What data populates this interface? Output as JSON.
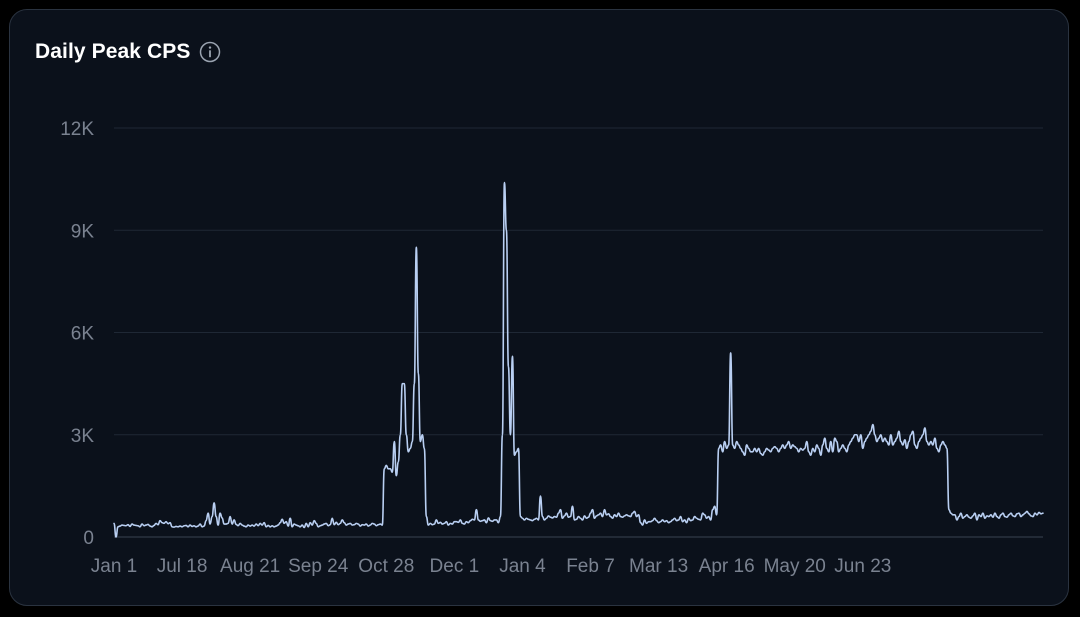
{
  "card": {
    "title": "Daily Peak CPS",
    "info_icon": "info-circle-icon"
  },
  "colors": {
    "background": "#0b111b",
    "border": "#2a3340",
    "line": "#b9cff2",
    "grid": "#1f2835",
    "tick_text": "#7a8290",
    "title_text": "#ffffff"
  },
  "chart_data": {
    "type": "line",
    "title": "Daily Peak CPS",
    "xlabel": "",
    "ylabel": "",
    "ylim": [
      0,
      12000
    ],
    "grid": true,
    "y_ticks": [
      {
        "value": 0,
        "label": "0"
      },
      {
        "value": 3000,
        "label": "3K"
      },
      {
        "value": 6000,
        "label": "6K"
      },
      {
        "value": 9000,
        "label": "9K"
      },
      {
        "value": 12000,
        "label": "12K"
      }
    ],
    "x_ticks": [
      {
        "index": 0,
        "label": "Jan 1"
      },
      {
        "index": 34,
        "label": "Jul 18"
      },
      {
        "index": 68,
        "label": "Aug 21"
      },
      {
        "index": 102,
        "label": "Sep 24"
      },
      {
        "index": 136,
        "label": "Oct 28"
      },
      {
        "index": 170,
        "label": "Dec 1"
      },
      {
        "index": 204,
        "label": "Jan 4"
      },
      {
        "index": 238,
        "label": "Feb 7"
      },
      {
        "index": 272,
        "label": "Mar 13"
      },
      {
        "index": 306,
        "label": "Apr 16"
      },
      {
        "index": 340,
        "label": "May 20"
      },
      {
        "index": 374,
        "label": "Jun 23"
      }
    ],
    "series": [
      {
        "values": [
          400,
          0,
          300,
          320,
          350,
          340,
          330,
          360,
          310,
          380,
          350,
          340,
          330,
          300,
          380,
          330,
          350,
          370,
          320,
          300,
          340,
          400,
          360,
          480,
          420,
          400,
          450,
          390,
          420,
          300,
          290,
          310,
          300,
          320,
          300,
          330,
          340,
          300,
          350,
          310,
          330,
          300,
          320,
          380,
          300,
          320,
          480,
          700,
          380,
          600,
          1000,
          600,
          350,
          700,
          560,
          380,
          380,
          400,
          600,
          380,
          500,
          370,
          330,
          400,
          350,
          320,
          300,
          350,
          320,
          350,
          320,
          380,
          330,
          400,
          350,
          420,
          300,
          340,
          300,
          330,
          300,
          320,
          350,
          420,
          520,
          400,
          450,
          320,
          550,
          300,
          380,
          350,
          330,
          300,
          350,
          280,
          400,
          300,
          420,
          350,
          480,
          400,
          300,
          330,
          350,
          380,
          400,
          330,
          360,
          550,
          360,
          430,
          360,
          400,
          500,
          420,
          350,
          380,
          400,
          350,
          360,
          400,
          380,
          320,
          360,
          350,
          380,
          320,
          350,
          400,
          380,
          330,
          360,
          380,
          350,
          2000,
          2100,
          2000,
          2000,
          1900,
          2800,
          1800,
          2200,
          3000,
          4500,
          4500,
          3000,
          2500,
          2600,
          2800,
          4500,
          8500,
          4800,
          2800,
          3000,
          2600,
          600,
          350,
          400,
          360,
          380,
          500,
          400,
          430,
          380,
          400,
          450,
          350,
          400,
          380,
          450,
          450,
          430,
          500,
          400,
          380,
          450,
          420,
          480,
          520,
          500,
          800,
          500,
          460,
          480,
          500,
          420,
          560,
          480,
          460,
          500,
          500,
          420,
          600,
          3000,
          10400,
          9000,
          5000,
          3000,
          5300,
          2400,
          2500,
          2600,
          600,
          550,
          500,
          550,
          520,
          500,
          480,
          520,
          550,
          500,
          1200,
          600,
          500,
          550,
          620,
          580,
          560,
          600,
          580,
          700,
          800,
          550,
          620,
          700,
          580,
          600,
          900,
          500,
          520,
          600,
          550,
          500,
          620,
          550,
          580,
          700,
          800,
          550,
          620,
          650,
          700,
          600,
          800,
          650,
          680,
          600,
          550,
          650,
          600,
          700,
          600,
          580,
          620,
          650,
          620,
          600,
          700,
          750,
          600,
          650,
          420,
          350,
          500,
          400,
          450,
          450,
          480,
          550,
          480,
          420,
          450,
          500,
          450,
          480,
          420,
          450,
          500,
          550,
          480,
          500,
          600,
          450,
          500,
          420,
          550,
          480,
          500,
          600,
          550,
          520,
          500,
          700,
          650,
          550,
          600,
          500,
          800,
          900,
          650,
          2600,
          2700,
          2500,
          2800,
          2600,
          2700,
          5400,
          2700,
          2600,
          2800,
          2700,
          2600,
          2500,
          2400,
          2700,
          2600,
          2500,
          2500,
          2600,
          2500,
          2600,
          2450,
          2400,
          2500,
          2600,
          2550,
          2500,
          2600,
          2650,
          2600,
          2500,
          2600,
          2700,
          2600,
          2700,
          2800,
          2600,
          2700,
          2650,
          2600,
          2500,
          2600,
          2550,
          2600,
          2800,
          2500,
          2400,
          2600,
          2500,
          2700,
          2600,
          2400,
          2700,
          2900,
          2600,
          2500,
          2800,
          2500,
          2900,
          2800,
          2500,
          2600,
          2700,
          2600,
          2500,
          2700,
          2800,
          2900,
          3000,
          3000,
          2800,
          3000,
          2600,
          2800,
          2900,
          3000,
          3100,
          3300,
          3000,
          2800,
          2900,
          3000,
          2800,
          2900,
          2800,
          2700,
          3000,
          2700,
          2800,
          2900,
          3100,
          2800,
          2700,
          2850,
          2600,
          2800,
          3000,
          3100,
          2700,
          2600,
          2800,
          2900,
          3000,
          3200,
          2800,
          2700,
          2800,
          2700,
          2900,
          2600,
          2500,
          2700,
          2800,
          2700,
          2600,
          800,
          700,
          650,
          650,
          500,
          600,
          700,
          550,
          600,
          650,
          580,
          550,
          620,
          700,
          500,
          650,
          600,
          700,
          550,
          620,
          600,
          650,
          580,
          700,
          600,
          550,
          650,
          700,
          600,
          580,
          650,
          700,
          620,
          600,
          680,
          700,
          600,
          650,
          700,
          750,
          680,
          620,
          600,
          700,
          650,
          720,
          680,
          700
        ]
      }
    ]
  }
}
